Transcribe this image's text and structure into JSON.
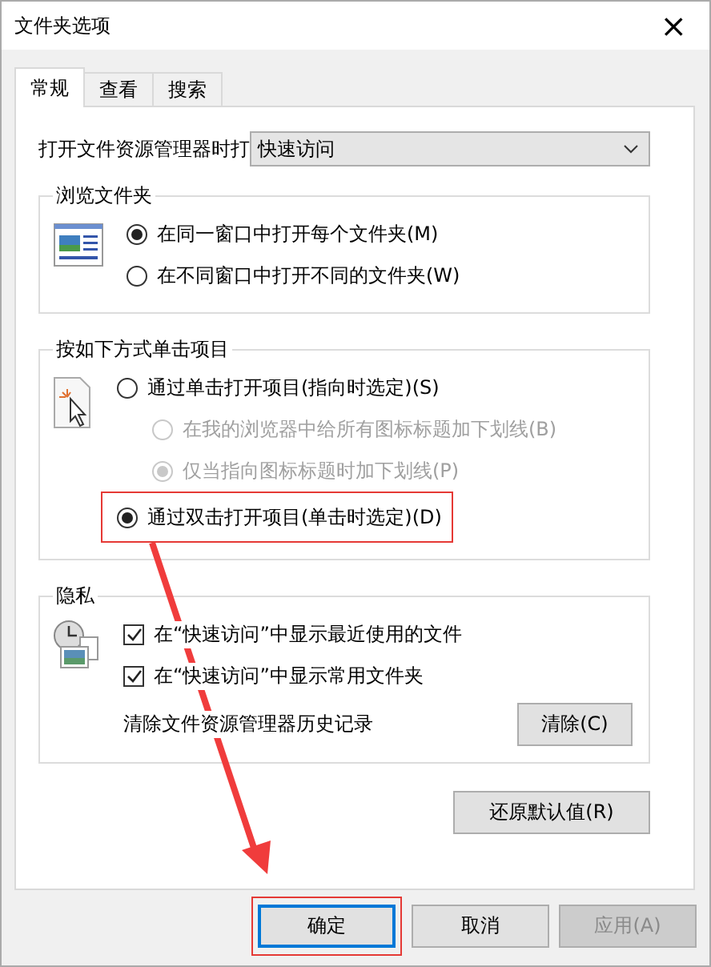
{
  "window": {
    "title": "文件夹选项",
    "close": "×"
  },
  "tabs": [
    {
      "label": "常规",
      "selected": true
    },
    {
      "label": "查看",
      "selected": false
    },
    {
      "label": "搜索",
      "selected": false
    }
  ],
  "open_in": {
    "label": "打开文件资源管理器时打",
    "value": "快速访问"
  },
  "groups": [
    {
      "title": "浏览文件夹",
      "options": [
        {
          "label": "在同一窗口中打开每个文件夹(M)",
          "selected": true,
          "disabled": false,
          "highlighted": false
        },
        {
          "label": "在不同窗口中打开不同的文件夹(W)",
          "selected": false,
          "disabled": false,
          "highlighted": false
        }
      ]
    },
    {
      "title": "按如下方式单击项目",
      "options": [
        {
          "label": "通过单击打开项目(指向时选定)(S)",
          "selected": false,
          "disabled": false,
          "highlighted": false,
          "children": [
            {
              "label": "在我的浏览器中给所有图标标题加下划线(B)",
              "selected": false,
              "disabled": true,
              "highlighted": false
            },
            {
              "label": "仅当指向图标标题时加下划线(P)",
              "selected": true,
              "disabled": true,
              "highlighted": false
            }
          ]
        },
        {
          "label": "通过双击打开项目(单击时选定)(D)",
          "selected": true,
          "disabled": false,
          "highlighted": true
        }
      ]
    }
  ],
  "privacy": {
    "title": "隐私",
    "options": [
      {
        "label": "在“快速访问”中显示最近使用的文件",
        "checked": true
      },
      {
        "label": "在“快速访问”中显示常用文件夹",
        "checked": true
      }
    ],
    "clear_label": "清除文件资源管理器历史记录",
    "clear_button": "清除(C)"
  },
  "restore_button": "还原默认值(R)",
  "buttons": [
    {
      "label": "确定",
      "default": true,
      "disabled": false,
      "highlighted": true
    },
    {
      "label": "取消",
      "default": false,
      "disabled": false,
      "highlighted": false
    },
    {
      "label": "应用(A)",
      "default": false,
      "disabled": true,
      "highlighted": false
    }
  ],
  "arrow": true
}
